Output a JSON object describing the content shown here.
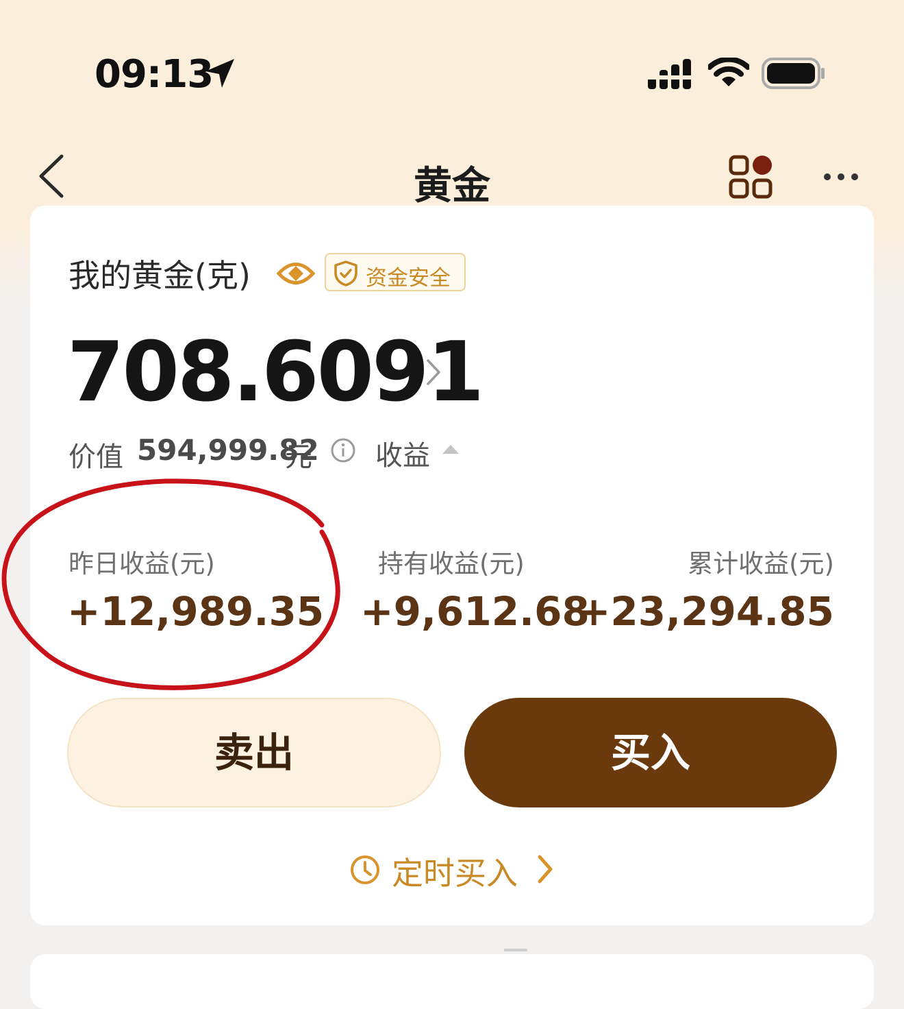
{
  "status_bar": {
    "time": "09:13"
  },
  "nav": {
    "title": "黄金"
  },
  "holding": {
    "label": "我的黄金(克)",
    "safety_badge": "资金安全",
    "amount": "708.6091",
    "value_label": "价值",
    "value_number": "594,999.82",
    "value_unit": "元",
    "profit_toggle_label": "收益"
  },
  "stats": [
    {
      "label": "昨日收益(元)",
      "value": "+12,989.35"
    },
    {
      "label": "持有收益(元)",
      "value": "+9,612.68"
    },
    {
      "label": "累计收益(元)",
      "value": "+23,294.85"
    }
  ],
  "actions": {
    "sell": "卖出",
    "buy": "买入",
    "scheduled": "定时买入"
  },
  "colors": {
    "header_bg": "#fbeedb",
    "accent_gold": "#c98a26",
    "profit_brown": "#5a3414",
    "buy_button": "#6b3a0c",
    "sell_button": "#fdf2e1",
    "annotation_red": "#c8121a"
  },
  "icons": [
    "location-arrow-icon",
    "signal-icon",
    "wifi-icon",
    "battery-icon",
    "back-chevron-icon",
    "apps-grid-icon",
    "more-icon",
    "eye-icon",
    "shield-check-icon",
    "chevron-right-icon",
    "info-icon",
    "triangle-up-icon",
    "clock-icon"
  ]
}
